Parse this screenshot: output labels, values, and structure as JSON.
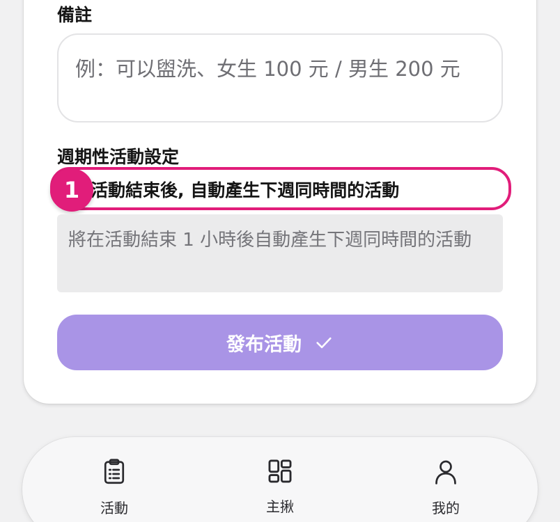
{
  "form": {
    "notes_label": "備註",
    "notes_placeholder": "例：可以盥洗、女生 100 元 / 男生 200 元",
    "recurring_label": "週期性活動設定",
    "recurring_checkbox_label": "活動結束後, 自動產生下週同時間的活動",
    "recurring_hint": "將在活動結束 1 小時後自動產生下週同時間的活動",
    "publish_label": "發布活動"
  },
  "annotation": {
    "step_number": "1",
    "color": "#e11d7a"
  },
  "tabbar": {
    "items": [
      {
        "label": "活動",
        "icon": "clipboard-list-icon"
      },
      {
        "label": "主揪",
        "icon": "grid-icon"
      },
      {
        "label": "我的",
        "icon": "user-icon"
      }
    ]
  },
  "colors": {
    "primary_button": "#a994e6",
    "background": "#f1f1f2",
    "hint_background": "#ebebec"
  }
}
